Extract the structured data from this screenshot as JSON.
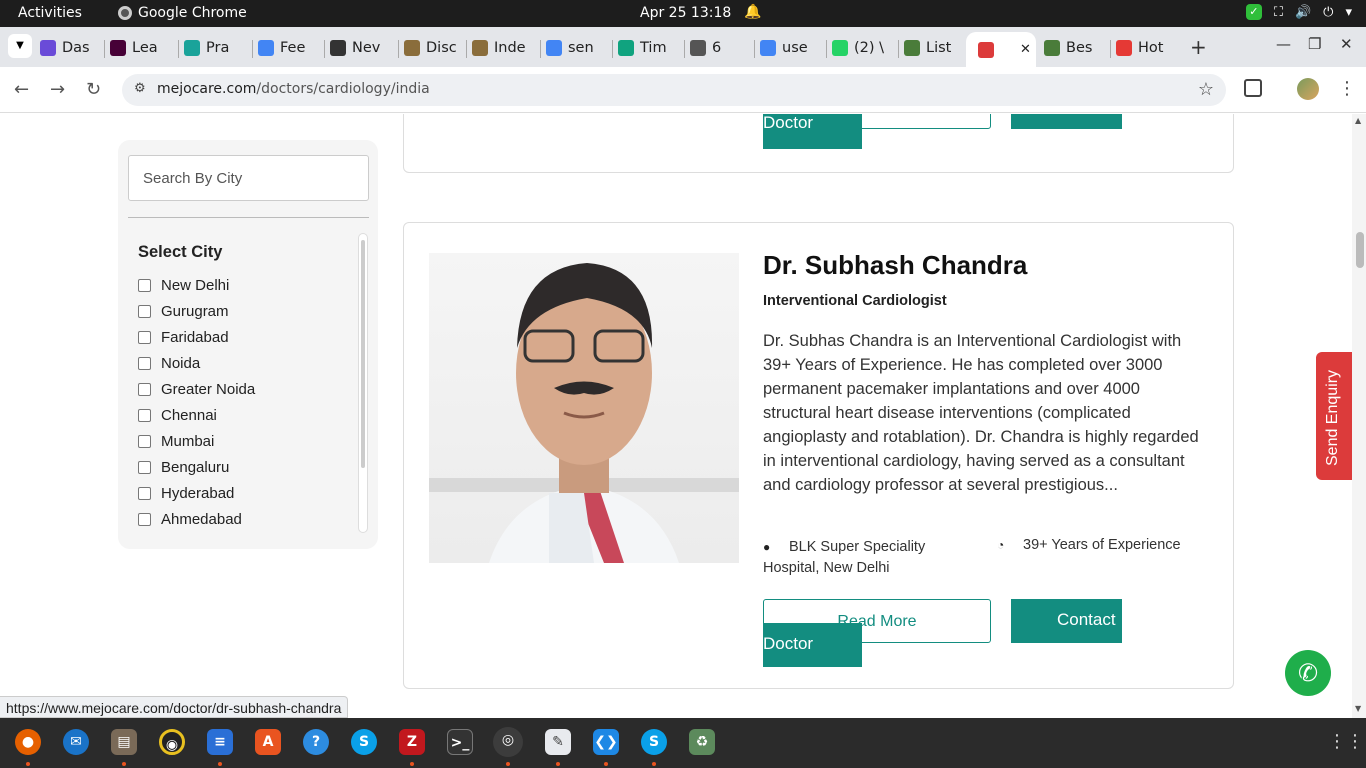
{
  "topbar": {
    "activities": "Activities",
    "app_name": "Google Chrome",
    "clock": "Apr 25  13:18"
  },
  "tabs": [
    {
      "label": "Das",
      "icon": "dashboard-icon",
      "color": "#6a4bd8"
    },
    {
      "label": "Lea",
      "icon": "xd-icon",
      "color": "#470137"
    },
    {
      "label": "Pra",
      "icon": "pra-icon",
      "color": "#1aa39a"
    },
    {
      "label": "Fee",
      "icon": "docs-icon",
      "color": "#4285f4"
    },
    {
      "label": "Nev",
      "icon": "github-icon",
      "color": "#333333"
    },
    {
      "label": "Disc",
      "icon": "disc-icon",
      "color": "#8a6d3b"
    },
    {
      "label": "Inde",
      "icon": "inde-icon",
      "color": "#8a6d3b"
    },
    {
      "label": "sen",
      "icon": "google-icon",
      "color": "#4285f4"
    },
    {
      "label": "Tim",
      "icon": "openai-icon",
      "color": "#10a37f"
    },
    {
      "label": "6",
      "icon": "globe-icon",
      "color": "#555555"
    },
    {
      "label": "use",
      "icon": "google-icon",
      "color": "#4285f4"
    },
    {
      "label": "(2) \\",
      "icon": "whatsapp-icon",
      "color": "#25d366"
    },
    {
      "label": "List",
      "icon": "list-icon",
      "color": "#4a7c3a"
    },
    {
      "label": "",
      "icon": "mejocare-icon",
      "color": "#dc3b3b"
    },
    {
      "label": "Bes",
      "icon": "bes-icon",
      "color": "#4a7c3a"
    },
    {
      "label": "Hot",
      "icon": "hot-icon",
      "color": "#e53935"
    }
  ],
  "address": {
    "host": "mejocare.com",
    "path": "/doctors/cardiology/india"
  },
  "filter": {
    "search_placeholder": "Search By City",
    "title": "Select City",
    "cities": [
      "New Delhi",
      "Gurugram",
      "Faridabad",
      "Noida",
      "Greater Noida",
      "Chennai",
      "Mumbai",
      "Bengaluru",
      "Hyderabad",
      "Ahmedabad"
    ]
  },
  "prev_card": {
    "contact_tail": "Doctor"
  },
  "doctor": {
    "name": "Dr. Subhash Chandra",
    "specialty": "Interventional Cardiologist",
    "bio": "Dr. Subhas Chandra is an Interventional Cardiologist with 39+ Years of Experience. He has completed over 3000 permanent pacemaker implantations and over 4000 structural heart disease interventions (complicated angioplasty and rotablation). Dr. Chandra is highly regarded in interventional cardiology, having served as a consultant and cardiology professor at several prestigious...",
    "hospital": "BLK Super Speciality Hospital, New Delhi",
    "experience": "39+ Years of Experience",
    "read_more": "Read More",
    "contact_line1": "Contact",
    "contact_line2": "Doctor"
  },
  "floating": {
    "send_enquiry": "Send Enquiry"
  },
  "status_url": "https://www.mejocare.com/doctor/dr-subhash-chandra",
  "colors": {
    "accent": "#138d80",
    "enquiry": "#dc3b3b",
    "whatsapp": "#1fae4b"
  }
}
